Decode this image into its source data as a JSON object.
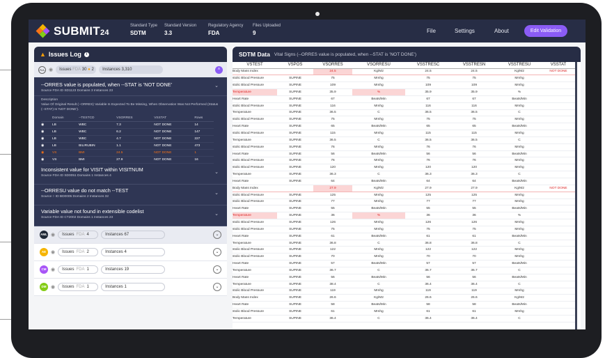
{
  "app": {
    "logo_text": "SUBMIT",
    "logo_sub": "24",
    "meta": [
      {
        "label": "Standard Type",
        "value": "SDTM"
      },
      {
        "label": "Standard Version",
        "value": "3.3"
      },
      {
        "label": "Regulatory Agency",
        "value": "FDA"
      },
      {
        "label": "Files Uploaded",
        "value": "9"
      }
    ],
    "nav": [
      "File",
      "Settings",
      "About"
    ],
    "edit_label": "Edit Validation",
    "colors": {
      "header": "#272d45",
      "accent": "#8b5cf6",
      "flag": "#dc2626"
    }
  },
  "issues_log": {
    "title": "Issues Log",
    "summary": {
      "badge": "ALL",
      "issues_label": "Issues",
      "agency": "FDA",
      "fda_count": "30",
      "warn_count": "2",
      "instances_label": "Instances 3,310"
    },
    "expanded": {
      "title": "--ORRES value is populated, when --STAT is 'NOT DONE'",
      "sub": "Source FDA     ID SD1123     Domains 3     Instances 23",
      "desc_label": "Description",
      "desc": "Value Of Original Result (--ORRES) Variable Is Expected To Be Missing, When Observation Was Not Performed (Status (--STAT) Is 'NOT DONE').",
      "columns": [
        "Domain",
        "--TESTCD",
        "VSORRES",
        "VSSTAT",
        "Rows"
      ],
      "rows": [
        [
          "LB",
          "WBC",
          "7.3",
          "NOT DONE",
          "14"
        ],
        [
          "LB",
          "WBC",
          "6.2",
          "NOT DONE",
          "147"
        ],
        [
          "LB",
          "WBC",
          "4.7",
          "NOT DONE",
          "227"
        ],
        [
          "LB",
          "BILIRUBIN",
          "1.1",
          "NOT DONE",
          "473"
        ],
        [
          "VS",
          "BMI",
          "24.5",
          "NOT DONE",
          "1"
        ],
        [
          "VS",
          "BMI",
          "27.9",
          "NOT DONE",
          "16"
        ]
      ],
      "highlight_row": 4
    },
    "issues": [
      {
        "title": "Inconsistent value for VISIT within VISITNUM",
        "sub": "Source FDA     ID SD0051     Domains 1     Instances 4"
      },
      {
        "title": "--ORRESU value do not match --TEST",
        "sub": "Source ○     ID BD0005     Domains 2     Instances 32"
      },
      {
        "title": "Variable value not found in extensible codelist",
        "sub": "Source FDA     ID CT2002     Domains 1     Instances 23"
      }
    ],
    "groups": [
      {
        "badge": "AML",
        "color": "#1f2937",
        "issues": "4",
        "instances": "Instances 67",
        "selected": true
      },
      {
        "badge": "AE",
        "color": "#f5b400",
        "issues": "2",
        "instances": "Instances 4",
        "selected": false
      },
      {
        "badge": "CM",
        "color": "#a855f7",
        "issues": "1",
        "instances": "Instances 19",
        "selected": false
      },
      {
        "badge": "DM",
        "color": "#84cc16",
        "issues": "1",
        "instances": "Instances 1",
        "selected": false
      }
    ]
  },
  "sdtm": {
    "title": "SDTM Data",
    "subtitle": "Vital Signs (--ORRES value is populated, when --STAT is 'NOT DONE')",
    "columns": [
      "VSTEST",
      "VSPOS",
      "VSORRES",
      "VSORRESU",
      "VSSTRESC",
      "VSSTRESN",
      "VSSTRESU",
      "VSSTAT"
    ],
    "rows": [
      [
        "Body Mass Index",
        "",
        "24.5",
        "Kg/M2",
        "24.5",
        "24.5",
        "Kg/M2",
        "NOT DONE"
      ],
      [
        "stolic Blood Pressure",
        "SUPINE",
        "75",
        "Mmhg",
        "75",
        "75",
        "Mmhg",
        ""
      ],
      [
        "stolic Blood Pressure",
        "SUPINE",
        "109",
        "Mmhg",
        "109",
        "109",
        "Mmhg",
        ""
      ],
      [
        "Temperature",
        "SUPINE",
        "35.9",
        "%",
        "35.9",
        "35.9",
        "%",
        ""
      ],
      [
        "Heart Rate",
        "SUPINE",
        "67",
        "Beats/Min",
        "67",
        "67",
        "Beats/Min",
        ""
      ],
      [
        "stolic Blood Pressure",
        "SUPINE",
        "116",
        "Mmhg",
        "116",
        "116",
        "Mmhg",
        ""
      ],
      [
        "Temperature",
        "SUPINE",
        "36.5",
        "C",
        "36.5",
        "36.5",
        "C",
        ""
      ],
      [
        "stolic Blood Pressure",
        "SUPINE",
        "75",
        "Mmhg",
        "75",
        "75",
        "Mmhg",
        ""
      ],
      [
        "Heart Rate",
        "SUPINE",
        "65",
        "Beats/Min",
        "65",
        "65",
        "Beats/Min",
        ""
      ],
      [
        "stolic Blood Pressure",
        "SUPINE",
        "115",
        "Mmhg",
        "115",
        "115",
        "Mmhg",
        ""
      ],
      [
        "Temperature",
        "SUPINE",
        "36.5",
        "C",
        "36.5",
        "36.5",
        "C",
        ""
      ],
      [
        "stolic Blood Pressure",
        "SUPINE",
        "76",
        "Mmhg",
        "76",
        "76",
        "Mmhg",
        ""
      ],
      [
        "Heart Rate",
        "SUPINE",
        "56",
        "Beats/Min",
        "56",
        "56",
        "Beats/Min",
        ""
      ],
      [
        "stolic Blood Pressure",
        "SUPINE",
        "76",
        "Mmhg",
        "76",
        "76",
        "Mmhg",
        ""
      ],
      [
        "stolic Blood Pressure",
        "SUPINE",
        "120",
        "Mmhg",
        "120",
        "120",
        "Mmhg",
        ""
      ],
      [
        "Temperature",
        "SUPINE",
        "36.3",
        "C",
        "36.3",
        "36.3",
        "C",
        ""
      ],
      [
        "Heart Rate",
        "SUPINE",
        "64",
        "Beats/Min",
        "64",
        "64",
        "Beats/Min",
        ""
      ],
      [
        "Body Mass Index",
        "",
        "27.9",
        "Kg/M2",
        "27.9",
        "27.9",
        "Kg/M2",
        "NOT DONE"
      ],
      [
        "stolic Blood Pressure",
        "SUPINE",
        "125",
        "Mmhg",
        "125",
        "125",
        "Mmhg",
        ""
      ],
      [
        "stolic Blood Pressure",
        "SUPINE",
        "77",
        "Mmhg",
        "77",
        "77",
        "Mmhg",
        ""
      ],
      [
        "Heart Rate",
        "SUPINE",
        "55",
        "Beats/Min",
        "55",
        "55",
        "Beats/Min",
        ""
      ],
      [
        "Temperature",
        "SUPINE",
        "36",
        "%",
        "36",
        "36",
        "%",
        ""
      ],
      [
        "stolic Blood Pressure",
        "SUPINE",
        "126",
        "Mmhg",
        "126",
        "126",
        "Mmhg",
        ""
      ],
      [
        "stolic Blood Pressure",
        "SUPINE",
        "75",
        "Mmhg",
        "75",
        "75",
        "Mmhg",
        ""
      ],
      [
        "Heart Rate",
        "SUPINE",
        "61",
        "Beats/Min",
        "61",
        "61",
        "Beats/Min",
        ""
      ],
      [
        "Temperature",
        "SUPINE",
        "36.8",
        "C",
        "36.8",
        "36.8",
        "C",
        ""
      ],
      [
        "stolic Blood Pressure",
        "SUPINE",
        "122",
        "Mmhg",
        "122",
        "122",
        "Mmhg",
        ""
      ],
      [
        "stolic Blood Pressure",
        "SUPINE",
        "70",
        "Mmhg",
        "70",
        "70",
        "Mmhg",
        ""
      ],
      [
        "Heart Rate",
        "SUPINE",
        "57",
        "Beats/Min",
        "57",
        "57",
        "Beats/Min",
        ""
      ],
      [
        "Temperature",
        "SUPINE",
        "36.7",
        "C",
        "36.7",
        "36.7",
        "C",
        ""
      ],
      [
        "Heart Rate",
        "SUPINE",
        "56",
        "Beats/Min",
        "56",
        "56",
        "Beats/Min",
        ""
      ],
      [
        "Temperature",
        "SUPINE",
        "38.4",
        "C",
        "36.4",
        "36.4",
        "C",
        ""
      ],
      [
        "stolic Blood Pressure",
        "SUPINE",
        "119",
        "Mmhg",
        "119",
        "119",
        "Mmhg",
        ""
      ],
      [
        "Body Mass Index",
        "SUPINE",
        "26.6",
        "Kg/M2",
        "26.6",
        "26.6",
        "Kg/M2",
        ""
      ],
      [
        "Heart Rate",
        "SUPINE",
        "58",
        "Beats/Min",
        "58",
        "58",
        "Beats/Min",
        ""
      ],
      [
        "stolic Blood Pressure",
        "SUPINE",
        "61",
        "Mmhg",
        "61",
        "61",
        "Mmhg",
        ""
      ],
      [
        "Temperature",
        "SUPINE",
        "36.4",
        "C",
        "36.4",
        "36.4",
        "C",
        ""
      ]
    ],
    "flag_rows": [
      0,
      17
    ],
    "bad_cells": [
      [
        0,
        2
      ],
      [
        3,
        0
      ],
      [
        3,
        3
      ],
      [
        17,
        2
      ],
      [
        21,
        0
      ],
      [
        21,
        3
      ]
    ]
  }
}
